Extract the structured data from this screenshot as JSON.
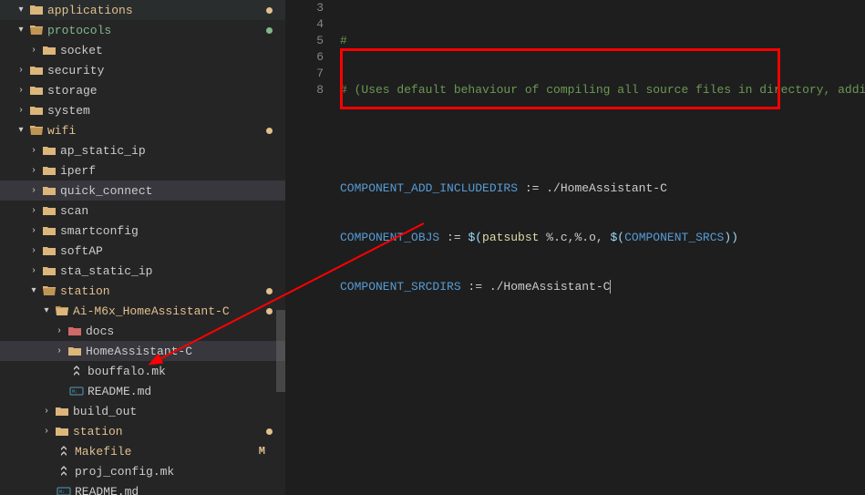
{
  "tree": {
    "applications": "applications",
    "protocols": "protocols",
    "socket": "socket",
    "security": "security",
    "storage": "storage",
    "system": "system",
    "wifi": "wifi",
    "ap_static_ip": "ap_static_ip",
    "iperf": "iperf",
    "quick_connect": "quick_connect",
    "scan": "scan",
    "smartconfig": "smartconfig",
    "softAP": "softAP",
    "sta_static_ip": "sta_static_ip",
    "station": "station",
    "ai_m6x": "Ai-M6x_HomeAssistant-C",
    "docs": "docs",
    "homeassistant_c": "HomeAssistant-C",
    "bouffalo": "bouffalo.mk",
    "readme": "README.md",
    "build_out": "build_out",
    "station2": "station",
    "makefile": "Makefile",
    "proj_config": "proj_config.mk",
    "readme2": "README.md"
  },
  "gutter": [
    "3",
    "4",
    "5",
    "6",
    "7",
    "8"
  ],
  "code": {
    "l3": "#",
    "l4_a": "# (Uses default behaviour of compiling all source files in directory, addi",
    "l6_a": "COMPONENT_ADD_INCLUDEDIRS",
    "l6_b": " := ./HomeAssistant-C",
    "l7_a": "COMPONENT_OBJS",
    "l7_b": " := ",
    "l7_c": "$(",
    "l7_d": "patsubst",
    "l7_e": " %.c,%.o, ",
    "l7_f": "$(",
    "l7_g": "COMPONENT_SRCS",
    "l7_h": ")",
    "l7_i": ")",
    "l8_a": "COMPONENT_SRCDIRS",
    "l8_b": " := ./HomeAssistant-C"
  },
  "badges": {
    "m": "M"
  }
}
